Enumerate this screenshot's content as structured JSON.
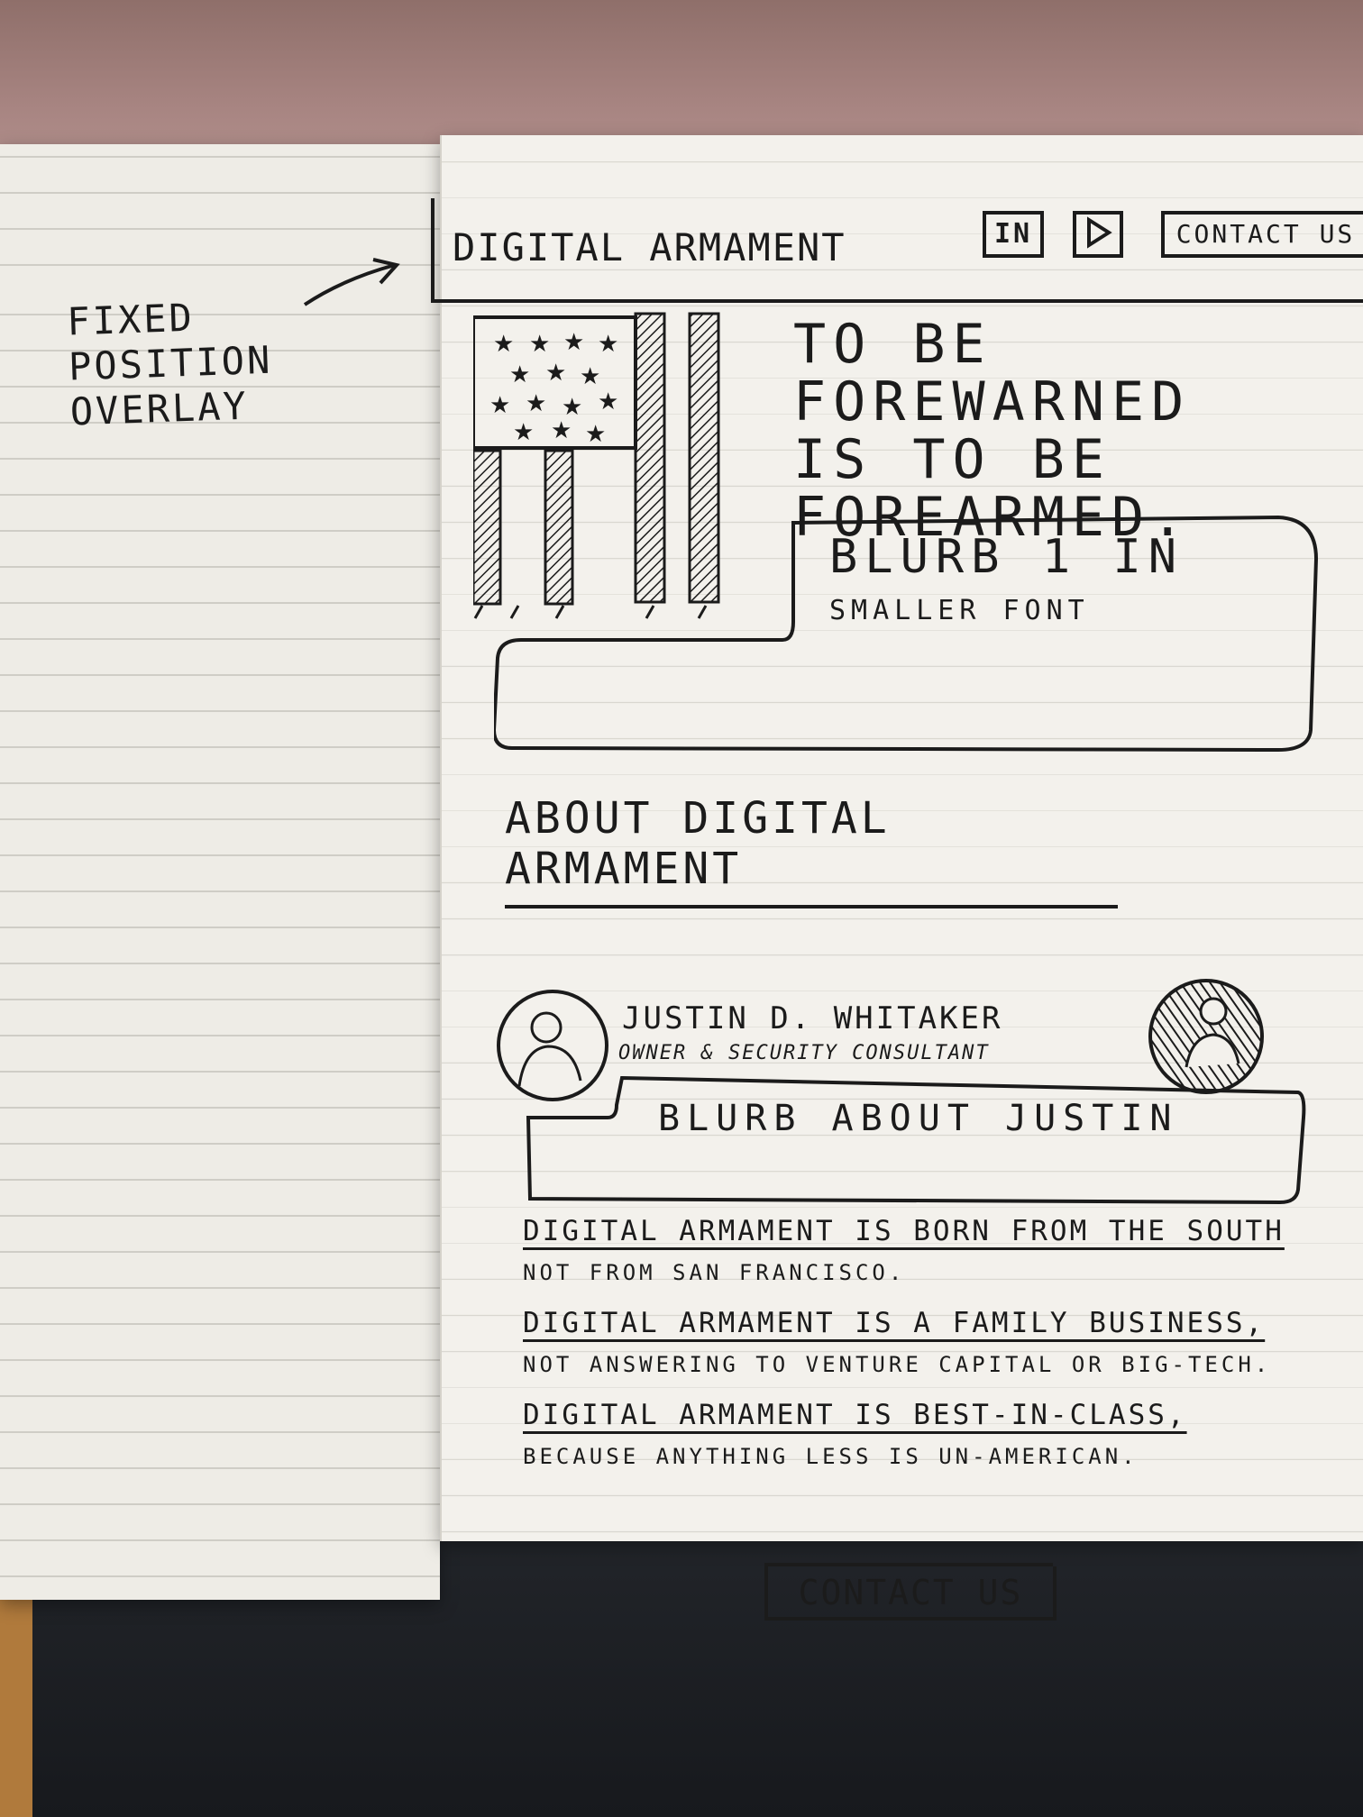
{
  "annotation": {
    "lines": [
      "FIXED",
      "POSITION",
      "OVERLAY"
    ]
  },
  "header": {
    "brand": "DIGITAL ARMAMENT",
    "linkedin_label": "in",
    "contact_label": "CONTACT US"
  },
  "hero": {
    "tagline_lines": [
      "TO BE FOREWARNED",
      "IS TO BE",
      "FOREARMED."
    ],
    "blurb_title": "BLURB 1 IN",
    "blurb_subtitle": "SMALLER FONT"
  },
  "about": {
    "heading": "ABOUT DIGITAL ARMAMENT",
    "person_name": "JUSTIN D. WHITAKER",
    "person_role": "OWNER & SECURITY CONSULTANT",
    "blurb": "BLURB ABOUT JUSTIN"
  },
  "statements": [
    {
      "main": "DIGITAL ARMAMENT IS BORN FROM THE SOUTH",
      "sub": "NOT FROM SAN FRANCISCO."
    },
    {
      "main": "DIGITAL ARMAMENT IS A FAMILY BUSINESS,",
      "sub": "NOT ANSWERING TO VENTURE CAPITAL OR BIG-TECH."
    },
    {
      "main": "DIGITAL ARMAMENT IS BEST-IN-CLASS,",
      "sub": "BECAUSE ANYTHING LESS IS UN-AMERICAN."
    }
  ],
  "footer": {
    "contact_label": "CONTACT US"
  }
}
